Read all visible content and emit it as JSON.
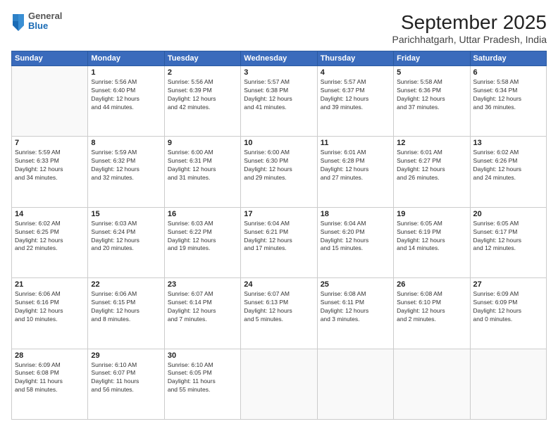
{
  "header": {
    "logo_general": "General",
    "logo_blue": "Blue",
    "month_title": "September 2025",
    "location": "Parichhatgarh, Uttar Pradesh, India"
  },
  "weekdays": [
    "Sunday",
    "Monday",
    "Tuesday",
    "Wednesday",
    "Thursday",
    "Friday",
    "Saturday"
  ],
  "weeks": [
    [
      {
        "day": "",
        "info": ""
      },
      {
        "day": "1",
        "info": "Sunrise: 5:56 AM\nSunset: 6:40 PM\nDaylight: 12 hours\nand 44 minutes."
      },
      {
        "day": "2",
        "info": "Sunrise: 5:56 AM\nSunset: 6:39 PM\nDaylight: 12 hours\nand 42 minutes."
      },
      {
        "day": "3",
        "info": "Sunrise: 5:57 AM\nSunset: 6:38 PM\nDaylight: 12 hours\nand 41 minutes."
      },
      {
        "day": "4",
        "info": "Sunrise: 5:57 AM\nSunset: 6:37 PM\nDaylight: 12 hours\nand 39 minutes."
      },
      {
        "day": "5",
        "info": "Sunrise: 5:58 AM\nSunset: 6:36 PM\nDaylight: 12 hours\nand 37 minutes."
      },
      {
        "day": "6",
        "info": "Sunrise: 5:58 AM\nSunset: 6:34 PM\nDaylight: 12 hours\nand 36 minutes."
      }
    ],
    [
      {
        "day": "7",
        "info": "Sunrise: 5:59 AM\nSunset: 6:33 PM\nDaylight: 12 hours\nand 34 minutes."
      },
      {
        "day": "8",
        "info": "Sunrise: 5:59 AM\nSunset: 6:32 PM\nDaylight: 12 hours\nand 32 minutes."
      },
      {
        "day": "9",
        "info": "Sunrise: 6:00 AM\nSunset: 6:31 PM\nDaylight: 12 hours\nand 31 minutes."
      },
      {
        "day": "10",
        "info": "Sunrise: 6:00 AM\nSunset: 6:30 PM\nDaylight: 12 hours\nand 29 minutes."
      },
      {
        "day": "11",
        "info": "Sunrise: 6:01 AM\nSunset: 6:28 PM\nDaylight: 12 hours\nand 27 minutes."
      },
      {
        "day": "12",
        "info": "Sunrise: 6:01 AM\nSunset: 6:27 PM\nDaylight: 12 hours\nand 26 minutes."
      },
      {
        "day": "13",
        "info": "Sunrise: 6:02 AM\nSunset: 6:26 PM\nDaylight: 12 hours\nand 24 minutes."
      }
    ],
    [
      {
        "day": "14",
        "info": "Sunrise: 6:02 AM\nSunset: 6:25 PM\nDaylight: 12 hours\nand 22 minutes."
      },
      {
        "day": "15",
        "info": "Sunrise: 6:03 AM\nSunset: 6:24 PM\nDaylight: 12 hours\nand 20 minutes."
      },
      {
        "day": "16",
        "info": "Sunrise: 6:03 AM\nSunset: 6:22 PM\nDaylight: 12 hours\nand 19 minutes."
      },
      {
        "day": "17",
        "info": "Sunrise: 6:04 AM\nSunset: 6:21 PM\nDaylight: 12 hours\nand 17 minutes."
      },
      {
        "day": "18",
        "info": "Sunrise: 6:04 AM\nSunset: 6:20 PM\nDaylight: 12 hours\nand 15 minutes."
      },
      {
        "day": "19",
        "info": "Sunrise: 6:05 AM\nSunset: 6:19 PM\nDaylight: 12 hours\nand 14 minutes."
      },
      {
        "day": "20",
        "info": "Sunrise: 6:05 AM\nSunset: 6:17 PM\nDaylight: 12 hours\nand 12 minutes."
      }
    ],
    [
      {
        "day": "21",
        "info": "Sunrise: 6:06 AM\nSunset: 6:16 PM\nDaylight: 12 hours\nand 10 minutes."
      },
      {
        "day": "22",
        "info": "Sunrise: 6:06 AM\nSunset: 6:15 PM\nDaylight: 12 hours\nand 8 minutes."
      },
      {
        "day": "23",
        "info": "Sunrise: 6:07 AM\nSunset: 6:14 PM\nDaylight: 12 hours\nand 7 minutes."
      },
      {
        "day": "24",
        "info": "Sunrise: 6:07 AM\nSunset: 6:13 PM\nDaylight: 12 hours\nand 5 minutes."
      },
      {
        "day": "25",
        "info": "Sunrise: 6:08 AM\nSunset: 6:11 PM\nDaylight: 12 hours\nand 3 minutes."
      },
      {
        "day": "26",
        "info": "Sunrise: 6:08 AM\nSunset: 6:10 PM\nDaylight: 12 hours\nand 2 minutes."
      },
      {
        "day": "27",
        "info": "Sunrise: 6:09 AM\nSunset: 6:09 PM\nDaylight: 12 hours\nand 0 minutes."
      }
    ],
    [
      {
        "day": "28",
        "info": "Sunrise: 6:09 AM\nSunset: 6:08 PM\nDaylight: 11 hours\nand 58 minutes."
      },
      {
        "day": "29",
        "info": "Sunrise: 6:10 AM\nSunset: 6:07 PM\nDaylight: 11 hours\nand 56 minutes."
      },
      {
        "day": "30",
        "info": "Sunrise: 6:10 AM\nSunset: 6:05 PM\nDaylight: 11 hours\nand 55 minutes."
      },
      {
        "day": "",
        "info": ""
      },
      {
        "day": "",
        "info": ""
      },
      {
        "day": "",
        "info": ""
      },
      {
        "day": "",
        "info": ""
      }
    ]
  ]
}
